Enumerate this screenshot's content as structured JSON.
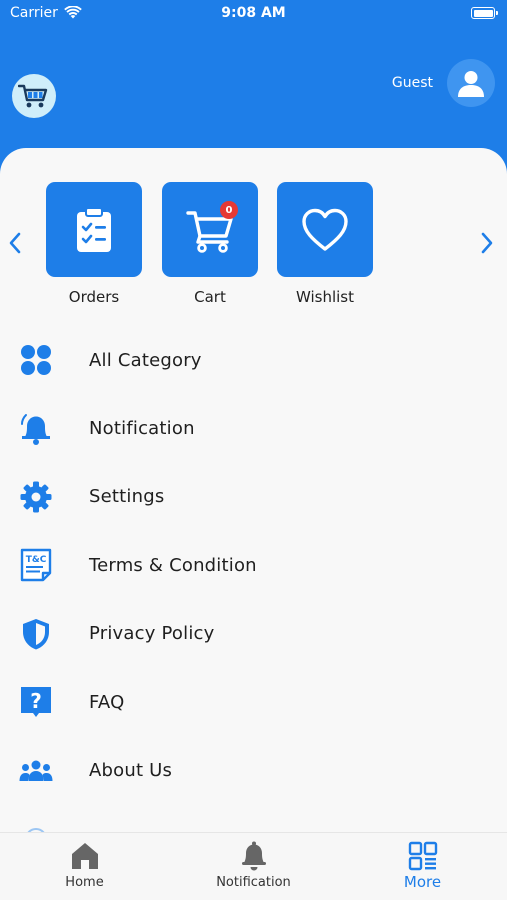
{
  "status_bar": {
    "carrier": "Carrier",
    "time": "9:08 AM"
  },
  "header": {
    "guest_label": "Guest"
  },
  "quick_actions": [
    {
      "label": "Orders",
      "icon": "clipboard-check-icon"
    },
    {
      "label": "Cart",
      "icon": "cart-icon",
      "badge": "0"
    },
    {
      "label": "Wishlist",
      "icon": "heart-icon"
    }
  ],
  "menu": {
    "items": [
      {
        "label": "All Category",
        "icon": "category-grid-icon"
      },
      {
        "label": "Notification",
        "icon": "bell-icon"
      },
      {
        "label": "Settings",
        "icon": "gear-icon"
      },
      {
        "label": "Terms & Condition",
        "icon": "terms-document-icon",
        "icon_text": "T&C"
      },
      {
        "label": "Privacy Policy",
        "icon": "shield-icon"
      },
      {
        "label": "FAQ",
        "icon": "question-icon",
        "icon_text": "?"
      },
      {
        "label": "About Us",
        "icon": "team-icon"
      }
    ]
  },
  "tab_bar": {
    "tabs": [
      {
        "label": "Home",
        "icon": "home-icon",
        "active": false
      },
      {
        "label": "Notification",
        "icon": "bell-icon",
        "active": false
      },
      {
        "label": "More",
        "icon": "qr-grid-icon",
        "active": true
      }
    ]
  },
  "colors": {
    "primary": "#1e7ee8",
    "sheet": "#f8f8f8",
    "badge": "#e53935",
    "tab_inactive": "#666666"
  }
}
